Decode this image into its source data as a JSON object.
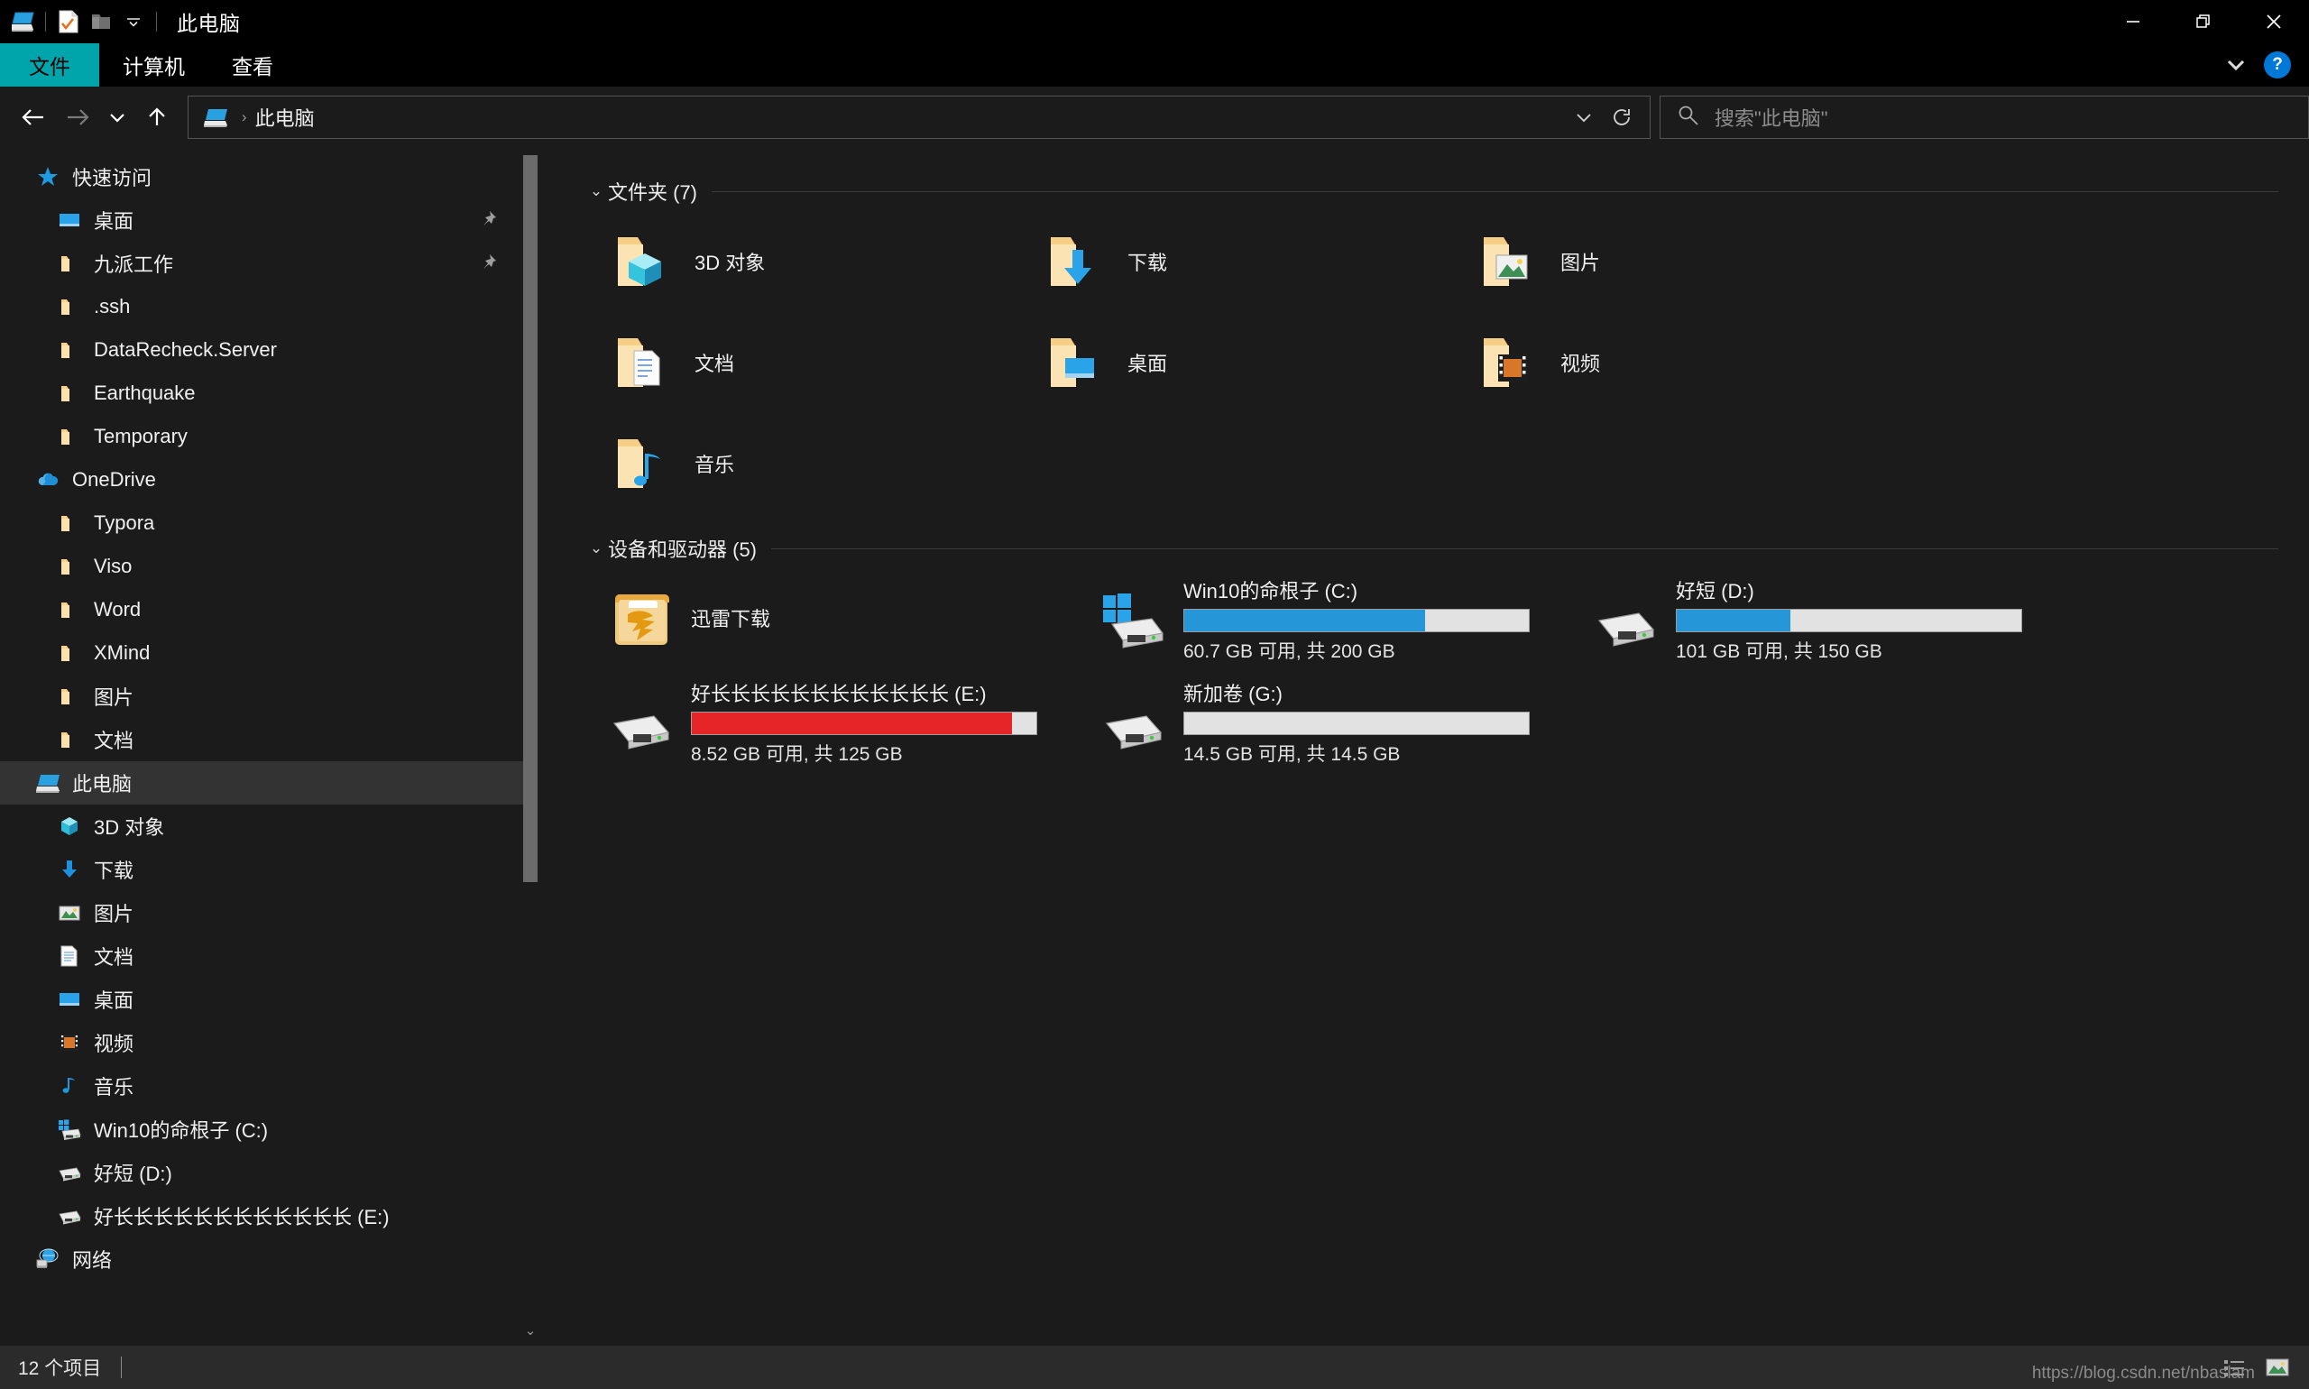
{
  "window": {
    "title": "此电脑",
    "quick_access_icons": [
      "this-pc-icon",
      "properties-icon",
      "new-folder-icon",
      "customize-dropdown-icon"
    ],
    "controls": {
      "minimize": "—",
      "restore": "❐",
      "close": "✕"
    }
  },
  "ribbon": {
    "tabs": [
      {
        "label": "文件",
        "active": true
      },
      {
        "label": "计算机",
        "active": false
      },
      {
        "label": "查看",
        "active": false
      }
    ],
    "expand_label": "⌄",
    "help_label": "?"
  },
  "address": {
    "back_label": "←",
    "forward_label": "→",
    "recent_label": "⌄",
    "up_label": "↑",
    "breadcrumb_sep": "›",
    "path": "此电脑",
    "dropdown_label": "⌄",
    "refresh_label": "↻"
  },
  "search": {
    "placeholder": "搜索\"此电脑\"",
    "value": "",
    "icon": "search-icon"
  },
  "sidebar": {
    "sections": [
      {
        "name": "快速访问",
        "icon": "star-icon",
        "items": [
          {
            "label": "桌面",
            "icon": "desktop-icon",
            "pinned": true
          },
          {
            "label": "九派工作",
            "icon": "folder-icon",
            "pinned": true
          },
          {
            "label": ".ssh",
            "icon": "folder-icon",
            "pinned": false
          },
          {
            "label": "DataRecheck.Server",
            "icon": "folder-icon",
            "pinned": false
          },
          {
            "label": "Earthquake",
            "icon": "folder-icon",
            "pinned": false
          },
          {
            "label": "Temporary",
            "icon": "folder-icon",
            "pinned": false
          }
        ]
      },
      {
        "name": "OneDrive",
        "icon": "onedrive-cloud-icon",
        "items": [
          {
            "label": "Typora",
            "icon": "folder-icon",
            "pinned": false
          },
          {
            "label": "Viso",
            "icon": "folder-icon",
            "pinned": false
          },
          {
            "label": "Word",
            "icon": "folder-icon",
            "pinned": false
          },
          {
            "label": "XMind",
            "icon": "folder-icon",
            "pinned": false
          },
          {
            "label": "图片",
            "icon": "folder-icon",
            "pinned": false
          },
          {
            "label": "文档",
            "icon": "folder-icon",
            "pinned": false
          }
        ]
      },
      {
        "name": "此电脑",
        "icon": "this-pc-icon",
        "selected": true,
        "items": [
          {
            "label": "3D 对象",
            "icon": "3d-objects-icon",
            "pinned": false
          },
          {
            "label": "下载",
            "icon": "downloads-icon",
            "pinned": false
          },
          {
            "label": "图片",
            "icon": "pictures-icon",
            "pinned": false
          },
          {
            "label": "文档",
            "icon": "documents-icon",
            "pinned": false
          },
          {
            "label": "桌面",
            "icon": "desktop-icon",
            "pinned": false
          },
          {
            "label": "视频",
            "icon": "videos-icon",
            "pinned": false
          },
          {
            "label": "音乐",
            "icon": "music-icon",
            "pinned": false
          },
          {
            "label": "Win10的命根子 (C:)",
            "icon": "windows-drive-icon",
            "pinned": false
          },
          {
            "label": "好短 (D:)",
            "icon": "drive-icon",
            "pinned": false
          },
          {
            "label": "好长长长长长长长长长长长长 (E:)",
            "icon": "drive-icon",
            "pinned": false
          }
        ]
      },
      {
        "name": "网络",
        "icon": "network-icon",
        "items": []
      }
    ],
    "scroll_down_label": "⌄"
  },
  "content": {
    "folders_group": {
      "chevron": "⌄",
      "title": "文件夹 (7)",
      "items": [
        {
          "name": "3D 对象",
          "icon": "folder-3d-objects-icon"
        },
        {
          "name": "下载",
          "icon": "folder-downloads-icon"
        },
        {
          "name": "图片",
          "icon": "folder-pictures-icon"
        },
        {
          "name": "文档",
          "icon": "folder-documents-icon"
        },
        {
          "name": "桌面",
          "icon": "folder-desktop-icon"
        },
        {
          "name": "视频",
          "icon": "folder-videos-icon"
        },
        {
          "name": "音乐",
          "icon": "folder-music-icon"
        }
      ]
    },
    "drives_group": {
      "chevron": "⌄",
      "title": "设备和驱动器 (5)",
      "items": [
        {
          "name": "迅雷下载",
          "icon": "thunder-folder-icon",
          "has_bar": false,
          "free_text": "",
          "fill_percent": 0,
          "bar_color": ""
        },
        {
          "name": "Win10的命根子 (C:)",
          "icon": "windows-drive-icon",
          "has_bar": true,
          "free_text": "60.7 GB 可用, 共 200 GB",
          "fill_percent": 70,
          "bar_color": "#2596d8"
        },
        {
          "name": "好短 (D:)",
          "icon": "drive-icon",
          "has_bar": true,
          "free_text": "101 GB 可用, 共 150 GB",
          "fill_percent": 33,
          "bar_color": "#2596d8"
        },
        {
          "name": "好长长长长长长长长长长长长 (E:)",
          "icon": "drive-icon",
          "has_bar": true,
          "free_text": "8.52 GB 可用, 共 125 GB",
          "fill_percent": 93,
          "bar_color": "#e52528"
        },
        {
          "name": "新加卷 (G:)",
          "icon": "drive-icon",
          "has_bar": true,
          "free_text": "14.5 GB 可用, 共 14.5 GB",
          "fill_percent": 0,
          "bar_color": "#2596d8"
        }
      ]
    }
  },
  "status": {
    "item_count": "12 个项目",
    "view_detail_label": "details-view-icon",
    "view_thumb_label": "thumbnail-view-icon"
  },
  "watermark": {
    "text": "https://blog.csdn.net/nbaslam"
  },
  "colors": {
    "accent_teal": "#00A5AC",
    "accent_blue": "#0078D7",
    "bar_blue": "#2596d8",
    "bar_red": "#e52528",
    "window_bg": "#1b1b1b",
    "titlebar_bg": "#000000",
    "status_bg": "#2b2b2b",
    "selection_bg": "#333333"
  }
}
